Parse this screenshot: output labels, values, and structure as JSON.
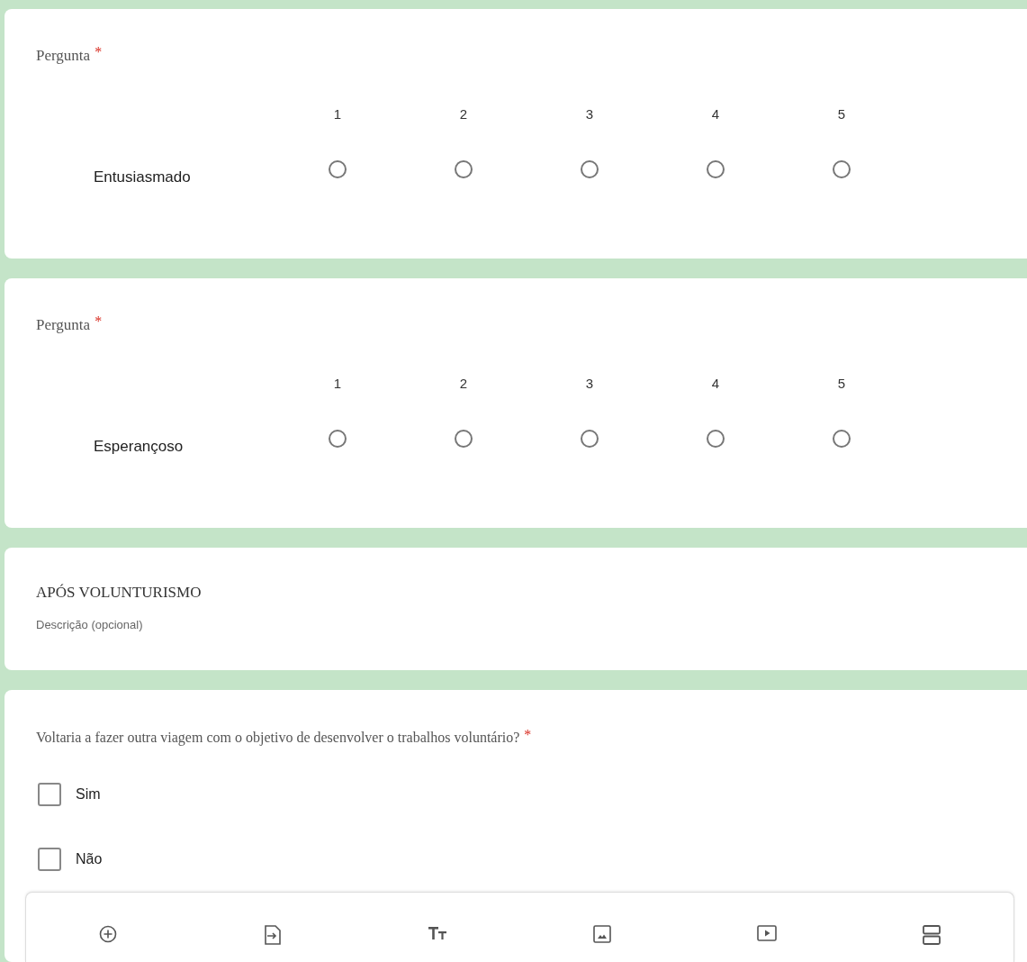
{
  "sections": [
    {
      "kind": "grid",
      "question": "Pergunta",
      "required_mark": "*",
      "columns": [
        "1",
        "2",
        "3",
        "4",
        "5"
      ],
      "rows": [
        {
          "label": "Entusiasmado",
          "options": [
            {
              "selected": false
            },
            {
              "selected": false
            },
            {
              "selected": false
            },
            {
              "selected": false
            },
            {
              "selected": false
            }
          ]
        }
      ]
    },
    {
      "kind": "grid",
      "question": "Pergunta",
      "required_mark": "*",
      "columns": [
        "1",
        "2",
        "3",
        "4",
        "5"
      ],
      "rows": [
        {
          "label": "Esperançoso",
          "options": [
            {
              "selected": false
            },
            {
              "selected": false
            },
            {
              "selected": false
            },
            {
              "selected": false
            },
            {
              "selected": false
            }
          ]
        }
      ]
    },
    {
      "kind": "header",
      "title": "APÓS VOLUNTURISMO",
      "description": "Descrição (opcional)"
    },
    {
      "kind": "checkbox",
      "question": "Voltaria a fazer outra viagem com o objetivo de desenvolver o trabalhos voluntário?",
      "required_mark": "*",
      "options": [
        {
          "label": "Sim",
          "checked": false
        },
        {
          "label": "Não",
          "checked": false
        }
      ]
    }
  ]
}
